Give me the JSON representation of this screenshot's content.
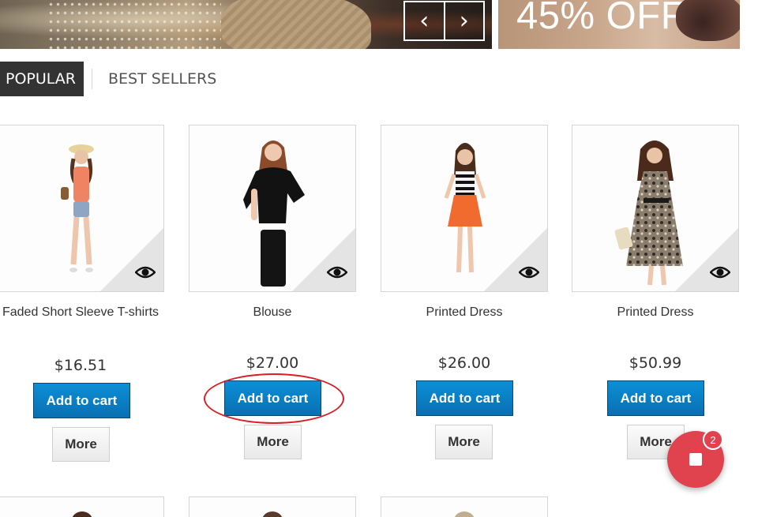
{
  "banners": {
    "slider_prev_icon": "chevron-left-icon",
    "slider_next_icon": "chevron-right-icon",
    "prev_glyph": "‹",
    "next_glyph": "›",
    "promo_text": "45% OFF"
  },
  "tabs": [
    {
      "label": "POPULAR",
      "active": true
    },
    {
      "label": "BEST SELLERS",
      "active": false
    }
  ],
  "products": [
    {
      "name": "Faded Short Sleeve T-shirts",
      "price": "$16.51",
      "cart_label": "Add to cart",
      "more_label": "More",
      "quick_view_icon": "eye-icon"
    },
    {
      "name": "Blouse",
      "price": "$27.00",
      "cart_label": "Add to cart",
      "more_label": "More",
      "quick_view_icon": "eye-icon"
    },
    {
      "name": "Printed Dress",
      "price": "$26.00",
      "cart_label": "Add to cart",
      "more_label": "More",
      "quick_view_icon": "eye-icon"
    },
    {
      "name": "Printed Dress",
      "price": "$50.99",
      "cart_label": "Add to cart",
      "more_label": "More",
      "quick_view_icon": "eye-icon"
    }
  ],
  "cart_fab": {
    "icon": "cart-icon",
    "badge_count": "2"
  },
  "colors": {
    "button_blue": "#0a7cc4",
    "tab_dark": "#333333",
    "fab_red": "#e0434e",
    "highlight_red": "#d81f26"
  }
}
